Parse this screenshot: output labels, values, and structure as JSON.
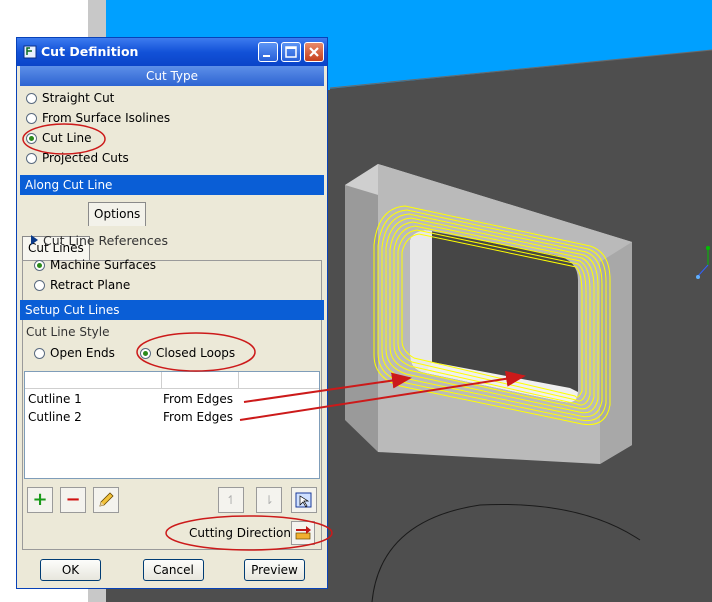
{
  "dialog": {
    "title": "Cut Definition",
    "cut_type_header": "Cut Type",
    "cut_type_options": [
      {
        "label": "Straight Cut",
        "selected": false
      },
      {
        "label": "From Surface Isolines",
        "selected": false
      },
      {
        "label": "Cut Line",
        "selected": true
      },
      {
        "label": "Projected Cuts",
        "selected": false
      }
    ],
    "along_header": "Along Cut Line",
    "tabs": [
      {
        "label": "Cut Lines",
        "active": true
      },
      {
        "label": "Options",
        "active": false
      }
    ],
    "references_label": "Cut Line References",
    "reference_options": [
      {
        "label": "Machine Surfaces",
        "selected": true
      },
      {
        "label": "Retract Plane",
        "selected": false
      }
    ],
    "setup_header": "Setup Cut Lines",
    "style_label": "Cut Line Style",
    "style_options": [
      {
        "label": "Open Ends",
        "selected": false
      },
      {
        "label": "Closed Loops",
        "selected": true
      }
    ],
    "cutlines": [
      {
        "name": "Cutline 1",
        "source": "From Edges"
      },
      {
        "name": "Cutline 2",
        "source": "From Edges"
      }
    ],
    "cutting_direction_label": "Cutting Direction",
    "buttons": {
      "ok": "OK",
      "cancel": "Cancel",
      "preview": "Preview"
    }
  },
  "colors": {
    "viewport_top": "#00a0ff",
    "viewport_floor": "#505050",
    "part_face": "#b8b8b8",
    "toolpath": "#ffff00",
    "annotation": "#cc1a1a",
    "title_bar": "#1252d8",
    "section_header": "#0a5ed6"
  },
  "icons": [
    "title-dialog-icon",
    "minimize-icon",
    "maximize-icon",
    "close-icon",
    "add-icon",
    "remove-icon",
    "edit-pencil-icon",
    "move-up-icon",
    "move-down-icon",
    "select-icon",
    "cutting-direction-icon"
  ]
}
